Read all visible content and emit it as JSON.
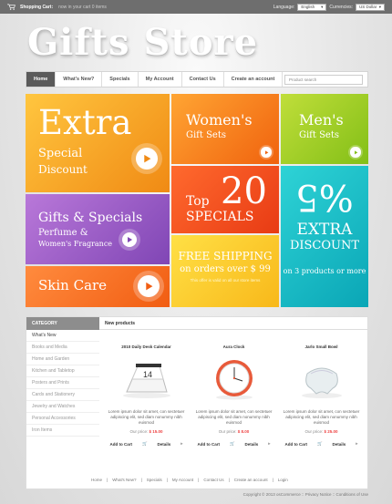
{
  "topbar": {
    "cart_label": "Shopping Cart:",
    "cart_info": "now in your cart 0 items",
    "language_label": "Language:",
    "language_value": "English",
    "currencies_label": "Currencies:",
    "currency_value": "US Dollar"
  },
  "logo": "Gifts Store",
  "nav": {
    "items": [
      "Home",
      "What's New?",
      "Specials",
      "My Account",
      "Contact Us",
      "Create an account"
    ],
    "search_placeholder": "Product search"
  },
  "banners": {
    "extra": {
      "l1": "Extra",
      "l2": "Special",
      "l3": "Discount"
    },
    "women": {
      "l1": "Women's",
      "l2": "Gift Sets"
    },
    "men": {
      "l1": "Men's",
      "l2": "Gift Sets"
    },
    "gifts": {
      "l1": "Gifts & Specials",
      "l2": "Perfume &",
      "l3": "Women's Fragrance"
    },
    "top20": {
      "top": "Top",
      "num": "20",
      "spec": "SPECIALS"
    },
    "discount": {
      "pct": "%5",
      "l1": "EXTRA",
      "l2": "DISCOUNT",
      "l3": "on 3 products or more"
    },
    "skin": {
      "l1": "Skin Care"
    },
    "shipping": {
      "l1": "FREE SHIPPING",
      "l2": "on orders over $ 99",
      "l3": "This offer is valid on all our store items"
    }
  },
  "sidebar": {
    "heading": "CATEGORY",
    "categories": [
      "What's New",
      "Books and Media",
      "Home and Garden",
      "Kitchen and Tabletop",
      "Posters and Prints",
      "Cards and Stationery",
      "Jewelry and Watches",
      "Personal Accessories",
      "Iron Items"
    ]
  },
  "content": {
    "heading": "New products",
    "products": [
      {
        "title": "2010 Daily Desk Calendar",
        "desc": "Lorem ipsum dolor sit amet, con sectetuer adipiscing elit, sed diam nonummy nibh euismod",
        "price_label": "Our price:",
        "price": "$ 15.00",
        "add": "Add to Cart",
        "details": "Details"
      },
      {
        "title": "Aura Clock",
        "desc": "Lorem ipsum dolor sit amet, con sectetuer adipiscing elit, sed diam nonummy nibh euismod",
        "price_label": "Our price:",
        "price": "$ 8.00",
        "add": "Add to Cart",
        "details": "Details"
      },
      {
        "title": "Jarlo Small Bowl",
        "desc": "Lorem ipsum dolor sit amet, con sectetuer adipiscing elit, sed diam nonummy nibh euismod",
        "price_label": "Our price:",
        "price": "$ 25.00",
        "add": "Add to Cart",
        "details": "Details"
      }
    ]
  },
  "footer": {
    "links": [
      "Home",
      "|",
      "What's New?",
      "|",
      "Specials",
      "|",
      "My Account",
      "|",
      "Contact Us",
      "|",
      "Create an account",
      "|",
      "Login"
    ],
    "copyright": "Copyright © 2013 osCommerce :: Privacy Notice :: Conditions of Use"
  },
  "colors": {
    "accent_orange": "#f08a14",
    "accent_green": "#83bf17",
    "accent_purple": "#8046b5",
    "accent_teal": "#0aa6b6",
    "accent_yellow": "#f8b81a"
  }
}
